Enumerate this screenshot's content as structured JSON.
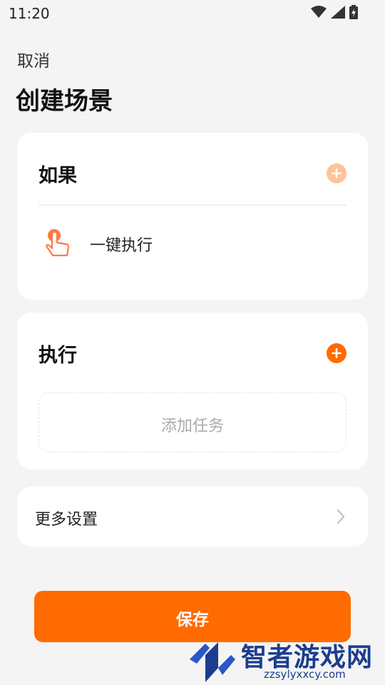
{
  "status_bar": {
    "time": "11:20",
    "icons": [
      "wifi-icon",
      "cell-signal-icon",
      "battery-charging-icon"
    ]
  },
  "header": {
    "cancel_label": "取消",
    "title": "创建场景"
  },
  "if_section": {
    "heading": "如果",
    "add_icon": "plus-circle-icon",
    "add_color": "#ffc39a",
    "trigger": {
      "icon": "hand-tap-icon",
      "label": "一键执行"
    }
  },
  "do_section": {
    "heading": "执行",
    "add_icon": "plus-circle-icon",
    "add_color": "#ff6b00",
    "add_task_label": "添加任务"
  },
  "more_settings": {
    "label": "更多设置",
    "icon": "chevron-right-icon"
  },
  "save_button": {
    "label": "保存",
    "color": "#ff6b00"
  },
  "watermark": {
    "title": "智者游戏网",
    "url": "zzsylyxxcy.com"
  }
}
